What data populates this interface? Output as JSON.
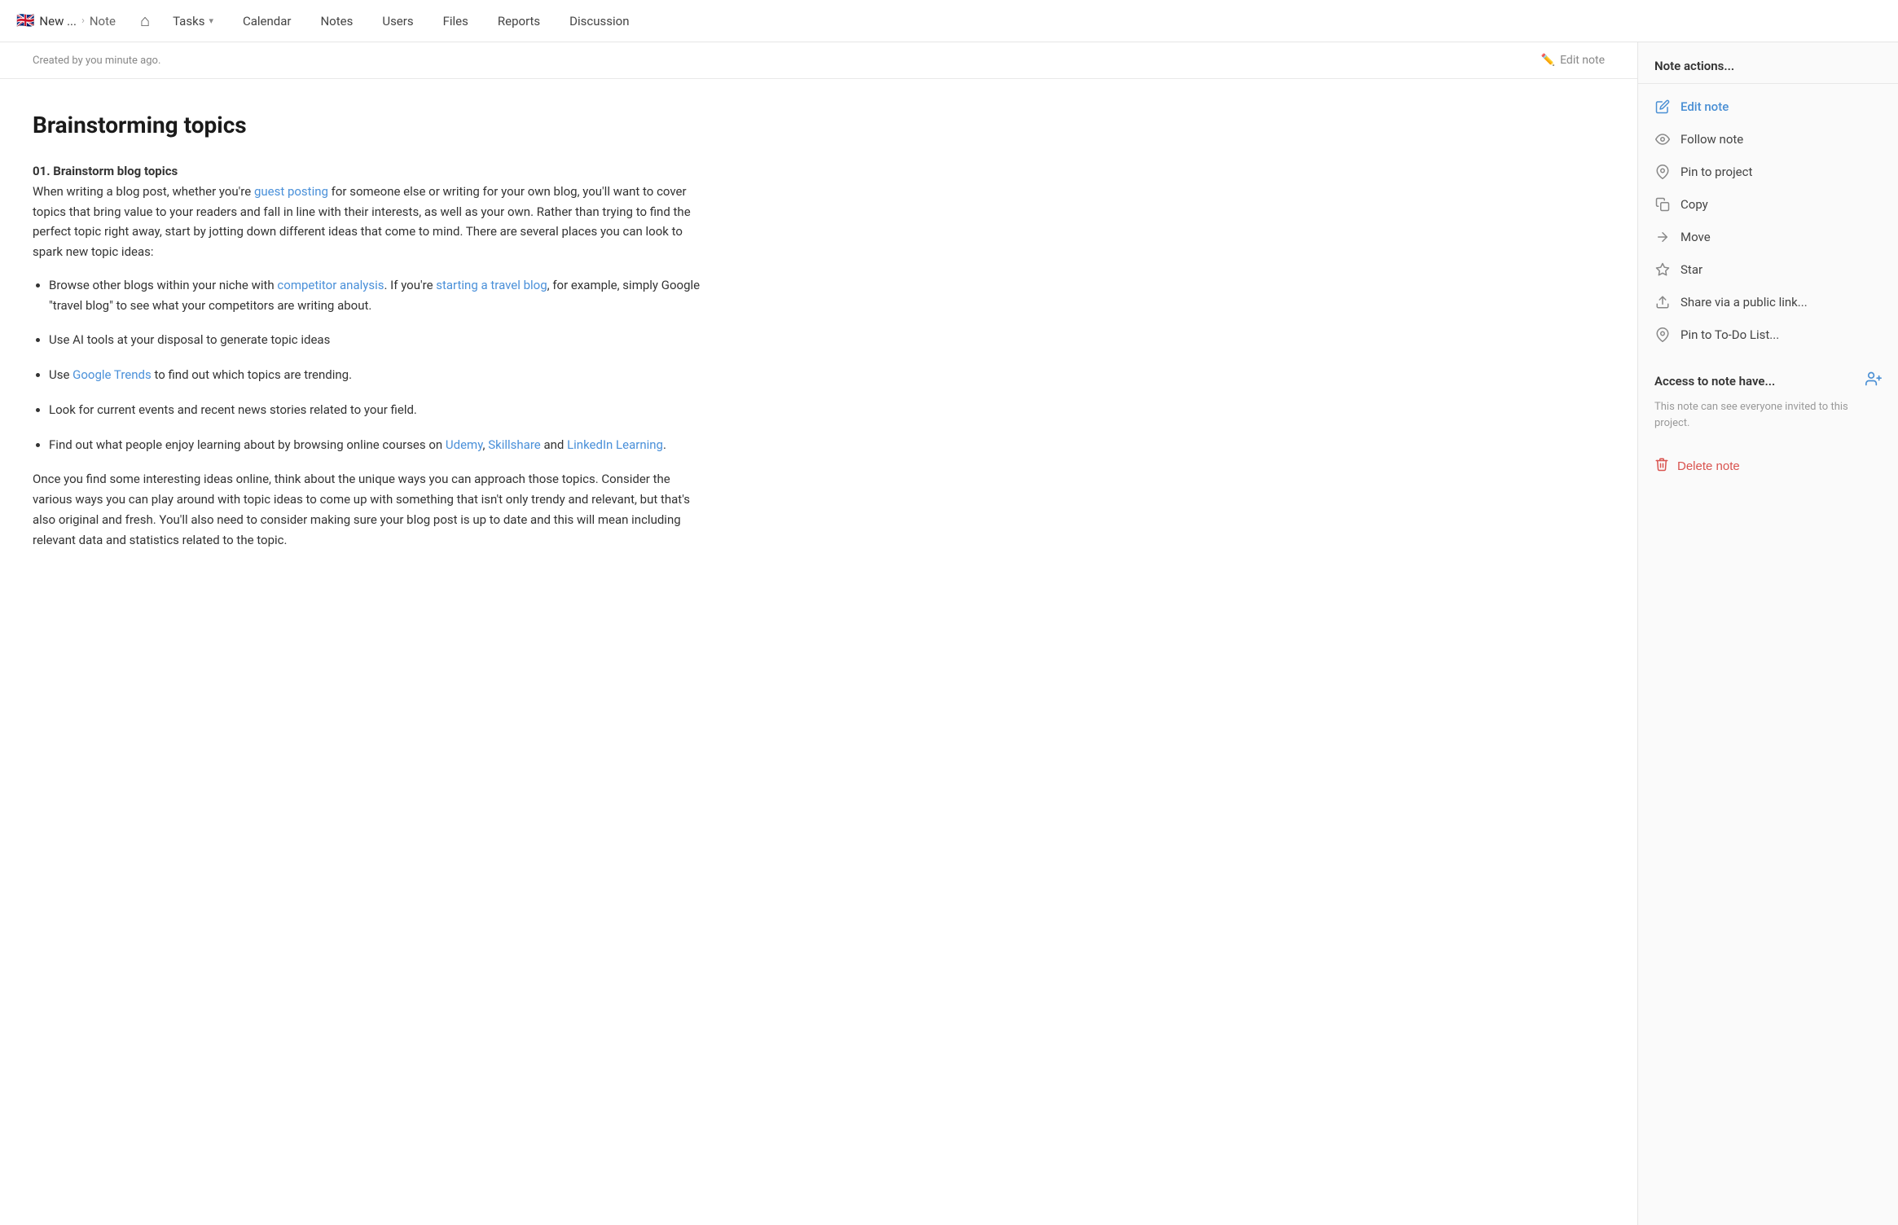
{
  "nav": {
    "breadcrumb": {
      "flag": "🇬🇧",
      "project": "New ...",
      "separator": "›",
      "current": "Note"
    },
    "home_icon": "⌂",
    "items": [
      {
        "label": "Tasks",
        "has_dropdown": true
      },
      {
        "label": "Calendar",
        "has_dropdown": false
      },
      {
        "label": "Notes",
        "has_dropdown": false
      },
      {
        "label": "Users",
        "has_dropdown": false
      },
      {
        "label": "Files",
        "has_dropdown": false
      },
      {
        "label": "Reports",
        "has_dropdown": false
      },
      {
        "label": "Discussion",
        "has_dropdown": false
      }
    ]
  },
  "sub_header": {
    "created_info": "Created by you minute ago.",
    "edit_note_link": "Edit note"
  },
  "note": {
    "title": "Brainstorming topics",
    "intro_heading": "01. Brainstorm blog topics",
    "intro_text": "When writing a blog post, whether you're ",
    "link1_text": "guest posting",
    "link1_href": "#",
    "intro_text2": " for someone else or writing for your own blog, you'll want to cover topics that bring value to your readers and fall in line with their interests, as well as your own. Rather than trying to find the perfect topic right away, start by jotting down different ideas that come to mind. There are several places you can look to spark new topic ideas:",
    "bullet_items": [
      {
        "text_before": "Browse other blogs within your niche with ",
        "link1_text": "competitor analysis",
        "link1_href": "#",
        "text_middle": ". If you're ",
        "link2_text": "starting a travel blog",
        "link2_href": "#",
        "text_after": ", for example, simply Google \"travel blog\" to see what your competitors are writing about."
      },
      {
        "text_before": "Use AI tools at your disposal to generate topic ideas",
        "link1_text": null,
        "link2_text": null,
        "text_after": ""
      },
      {
        "text_before": "Use ",
        "link1_text": "Google Trends",
        "link1_href": "#",
        "text_middle": " to find out which topics are trending.",
        "link2_text": null,
        "text_after": ""
      },
      {
        "text_before": "Look for current events and recent news stories related to your field.",
        "link1_text": null,
        "link2_text": null,
        "text_after": ""
      },
      {
        "text_before": "Find out what people enjoy learning about by browsing online courses on ",
        "link1_text": "Udemy",
        "link1_href": "#",
        "text_middle": ", ",
        "link2_text": "Skillshare",
        "link2_href": "#",
        "text_middle2": " and ",
        "link3_text": "LinkedIn Learning",
        "link3_href": "#",
        "text_after": "."
      }
    ],
    "closing_text": "Once you find some interesting ideas online, think about the unique ways you can approach those topics. Consider the various ways you can play around with topic ideas to come up with something that isn't only trendy and relevant, but that's also original and fresh. You'll also need to consider making sure your blog post is up to date and this will mean including relevant data and statistics related to the topic."
  },
  "sidebar": {
    "actions_title": "Note actions...",
    "actions": [
      {
        "id": "edit-note",
        "label": "Edit note",
        "icon": "✏️",
        "active": true
      },
      {
        "id": "follow-note",
        "label": "Follow note",
        "icon": "👁",
        "active": false
      },
      {
        "id": "pin-to-project",
        "label": "Pin to project",
        "icon": "📌",
        "active": false
      },
      {
        "id": "copy",
        "label": "Copy",
        "icon": "⧉",
        "active": false
      },
      {
        "id": "move",
        "label": "Move",
        "icon": "→",
        "active": false
      },
      {
        "id": "star",
        "label": "Star",
        "icon": "☆",
        "active": false
      },
      {
        "id": "share",
        "label": "Share via a public link...",
        "icon": "↑",
        "active": false
      },
      {
        "id": "pin-todo",
        "label": "Pin to To-Do List...",
        "icon": "📌",
        "active": false
      }
    ],
    "access_title": "Access to note have...",
    "access_desc": "This note can see everyone invited to this project.",
    "delete_label": "Delete note"
  }
}
